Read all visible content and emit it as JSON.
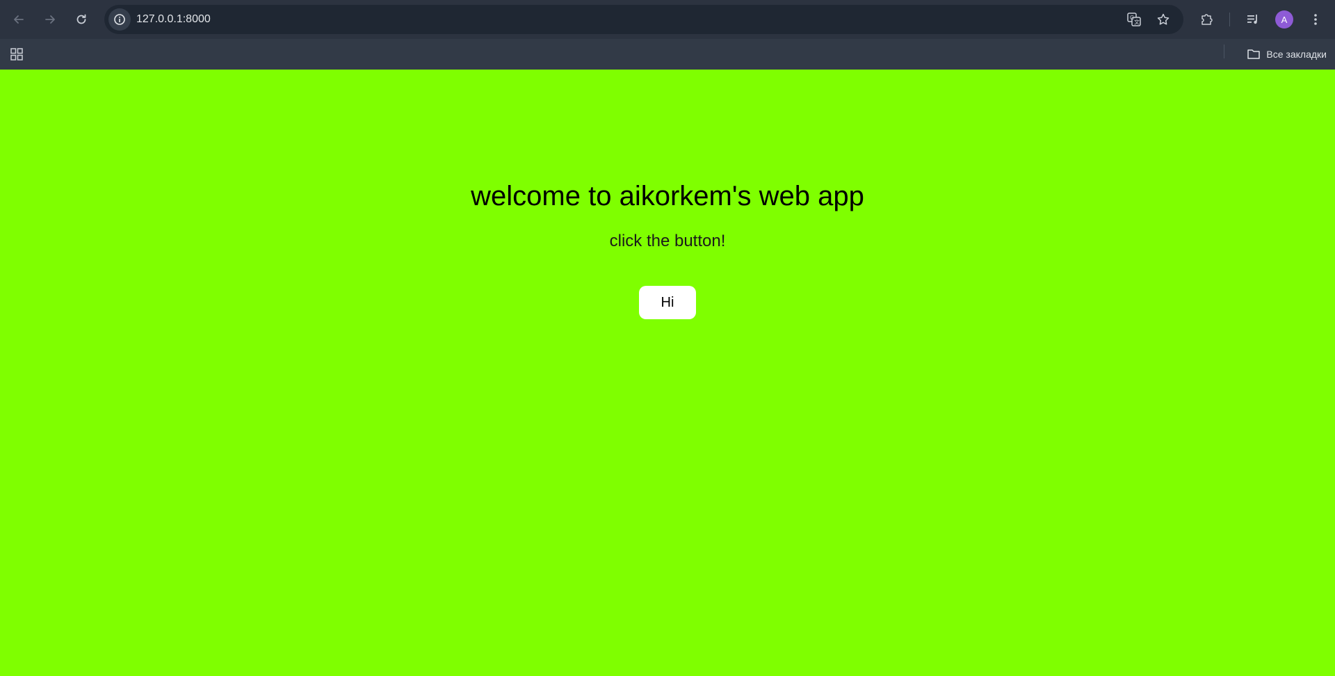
{
  "browser": {
    "url": "127.0.0.1:8000",
    "bookmarks_label": "Все закладки",
    "profile_initial": "A",
    "icons": {
      "back": "back-arrow-icon",
      "forward": "forward-arrow-icon",
      "reload": "reload-icon",
      "site_info": "info-icon",
      "translate": "translate-icon",
      "bookmark_star": "star-icon",
      "extensions": "puzzle-icon",
      "media": "media-queue-icon",
      "menu": "kebab-menu-icon",
      "apps": "apps-grid-icon",
      "folder": "folder-icon"
    }
  },
  "page": {
    "title": "welcome to aikorkem's web app",
    "subtitle": "click the button!",
    "button_label": "Hi"
  },
  "colors": {
    "page_background": "#7fff00",
    "browser_chrome": "#323a47",
    "button_background": "#ffffff",
    "avatar": "#8e5bd6"
  }
}
